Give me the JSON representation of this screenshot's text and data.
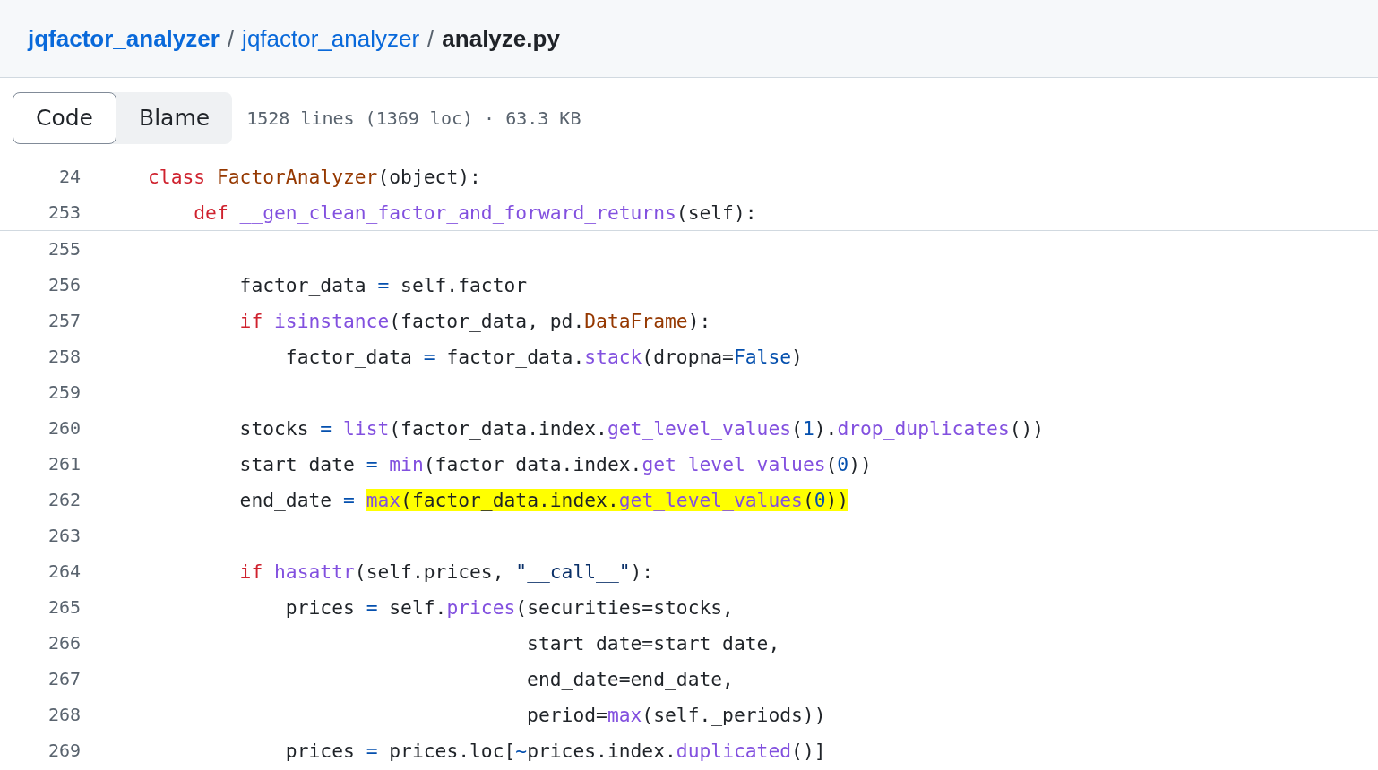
{
  "breadcrumb": [
    {
      "label": "jqfactor_analyzer",
      "kind": "link"
    },
    {
      "label": "/",
      "kind": "sep"
    },
    {
      "label": "jqfactor_analyzer",
      "kind": "link"
    },
    {
      "label": "/",
      "kind": "sep"
    },
    {
      "label": "analyze.py",
      "kind": "current"
    }
  ],
  "tabs": [
    {
      "label": "Code",
      "selected": true
    },
    {
      "label": "Blame",
      "selected": false
    }
  ],
  "file_info": "1528 lines (1369 loc) · 63.3 KB",
  "sticky_lines": [
    {
      "number": "24",
      "tokens": [
        {
          "text": "class ",
          "kind": "keyword"
        },
        {
          "text": "FactorAnalyzer",
          "kind": "type"
        },
        {
          "text": "(object):",
          "kind": "plain"
        }
      ]
    },
    {
      "number": "253",
      "tokens": [
        {
          "text": "    def ",
          "kind": "keyword"
        },
        {
          "text": "__gen_clean_factor_and_forward_returns",
          "kind": "func"
        },
        {
          "text": "(self):",
          "kind": "plain"
        }
      ]
    }
  ],
  "lines": [
    {
      "number": "255"
    },
    {
      "number": "256",
      "tokens": [
        {
          "text": "        factor_data ",
          "kind": "plain"
        },
        {
          "text": "=",
          "kind": "op"
        },
        {
          "text": " self.factor",
          "kind": "plain"
        }
      ]
    },
    {
      "number": "257",
      "tokens": [
        {
          "text": "        if ",
          "kind": "keyword"
        },
        {
          "text": "isinstance",
          "kind": "func"
        },
        {
          "text": "(factor_data, pd.",
          "kind": "plain"
        },
        {
          "text": "DataFrame",
          "kind": "type"
        },
        {
          "text": "):",
          "kind": "plain"
        }
      ]
    },
    {
      "number": "258",
      "tokens": [
        {
          "text": "            factor_data ",
          "kind": "plain"
        },
        {
          "text": "=",
          "kind": "op"
        },
        {
          "text": " factor_data.",
          "kind": "plain"
        },
        {
          "text": "stack",
          "kind": "func"
        },
        {
          "text": "(dropna=",
          "kind": "plain"
        },
        {
          "text": "False",
          "kind": "const"
        },
        {
          "text": ")",
          "kind": "plain"
        }
      ]
    },
    {
      "number": "259"
    },
    {
      "number": "260",
      "tokens": [
        {
          "text": "        stocks ",
          "kind": "plain"
        },
        {
          "text": "= ",
          "kind": "op"
        },
        {
          "text": "list",
          "kind": "func"
        },
        {
          "text": "(factor_data.index.",
          "kind": "plain"
        },
        {
          "text": "get_level_values",
          "kind": "func"
        },
        {
          "text": "(",
          "kind": "plain"
        },
        {
          "text": "1",
          "kind": "const"
        },
        {
          "text": ").",
          "kind": "plain"
        },
        {
          "text": "drop_duplicates",
          "kind": "func"
        },
        {
          "text": "())",
          "kind": "plain"
        }
      ]
    },
    {
      "number": "261",
      "tokens": [
        {
          "text": "        start_date ",
          "kind": "plain"
        },
        {
          "text": "= ",
          "kind": "op"
        },
        {
          "text": "min",
          "kind": "func"
        },
        {
          "text": "(factor_data.index.",
          "kind": "plain"
        },
        {
          "text": "get_level_values",
          "kind": "func"
        },
        {
          "text": "(",
          "kind": "plain"
        },
        {
          "text": "0",
          "kind": "const"
        },
        {
          "text": "))",
          "kind": "plain"
        }
      ]
    },
    {
      "number": "262",
      "tokens": [
        {
          "text": "        end_date ",
          "kind": "plain"
        },
        {
          "text": "= ",
          "kind": "op"
        }
      ],
      "highlight_tokens": [
        {
          "text": "max",
          "kind": "func"
        },
        {
          "text": "(factor_data.index.",
          "kind": "plain"
        },
        {
          "text": "get_level_values",
          "kind": "func"
        },
        {
          "text": "(",
          "kind": "plain"
        },
        {
          "text": "0",
          "kind": "const"
        },
        {
          "text": "))",
          "kind": "plain"
        }
      ]
    },
    {
      "number": "263"
    },
    {
      "number": "264",
      "tokens": [
        {
          "text": "        if ",
          "kind": "keyword"
        },
        {
          "text": "hasattr",
          "kind": "func"
        },
        {
          "text": "(self.prices, ",
          "kind": "plain"
        },
        {
          "text": "\"__call__\"",
          "kind": "string"
        },
        {
          "text": "):",
          "kind": "plain"
        }
      ]
    },
    {
      "number": "265",
      "tokens": [
        {
          "text": "            prices ",
          "kind": "plain"
        },
        {
          "text": "=",
          "kind": "op"
        },
        {
          "text": " self.",
          "kind": "plain"
        },
        {
          "text": "prices",
          "kind": "func"
        },
        {
          "text": "(securities=stocks,",
          "kind": "plain"
        }
      ]
    },
    {
      "number": "266",
      "tokens": [
        {
          "text": "                                 start_date=start_date,",
          "kind": "plain"
        }
      ]
    },
    {
      "number": "267",
      "tokens": [
        {
          "text": "                                 end_date=end_date,",
          "kind": "plain"
        }
      ]
    },
    {
      "number": "268",
      "tokens": [
        {
          "text": "                                 period=",
          "kind": "plain"
        },
        {
          "text": "max",
          "kind": "func"
        },
        {
          "text": "(self._periods))",
          "kind": "plain"
        }
      ]
    },
    {
      "number": "269",
      "tokens": [
        {
          "text": "            prices ",
          "kind": "plain"
        },
        {
          "text": "=",
          "kind": "op"
        },
        {
          "text": " prices.loc[",
          "kind": "plain"
        },
        {
          "text": "~",
          "kind": "op"
        },
        {
          "text": "prices.index.",
          "kind": "plain"
        },
        {
          "text": "duplicated",
          "kind": "func"
        },
        {
          "text": "()]",
          "kind": "plain"
        }
      ]
    }
  ]
}
